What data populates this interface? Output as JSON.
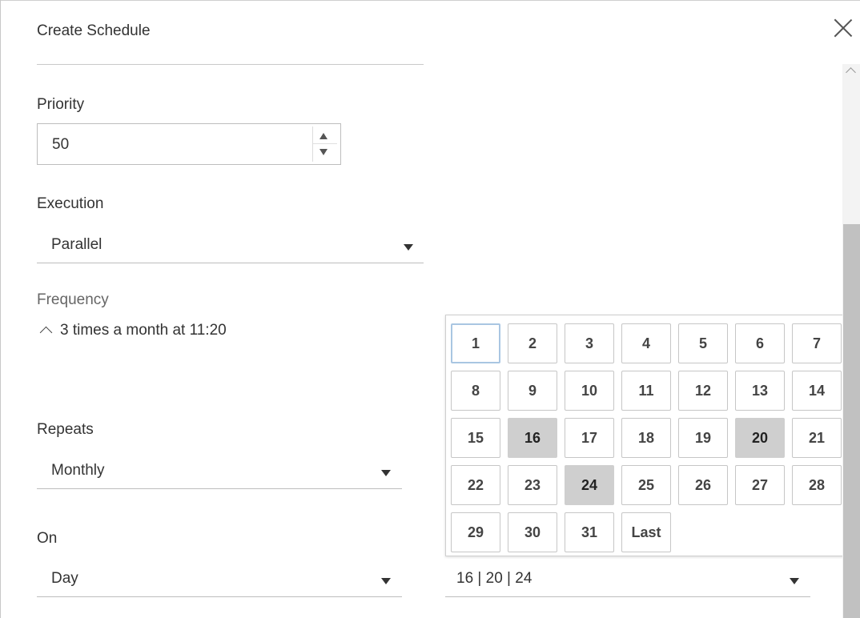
{
  "dialog": {
    "title": "Create Schedule"
  },
  "priority": {
    "label": "Priority",
    "value": "50"
  },
  "execution": {
    "label": "Execution",
    "value": "Parallel"
  },
  "frequency": {
    "label": "Frequency",
    "summary": "3 times a month at 11:20"
  },
  "repeats": {
    "label": "Repeats",
    "value": "Monthly"
  },
  "on": {
    "label": "On",
    "value": "Day"
  },
  "days_select": {
    "value": "16 | 20 | 24"
  },
  "calendar": {
    "days": [
      "1",
      "2",
      "3",
      "4",
      "5",
      "6",
      "7",
      "8",
      "9",
      "10",
      "11",
      "12",
      "13",
      "14",
      "15",
      "16",
      "17",
      "18",
      "19",
      "20",
      "21",
      "22",
      "23",
      "24",
      "25",
      "26",
      "27",
      "28",
      "29",
      "30",
      "31",
      "Last"
    ],
    "selected": [
      "16",
      "20",
      "24"
    ],
    "focused": "1"
  },
  "colors": {
    "selected_bg": "#cfcfcf",
    "focus_border": "#a9c6e2"
  }
}
